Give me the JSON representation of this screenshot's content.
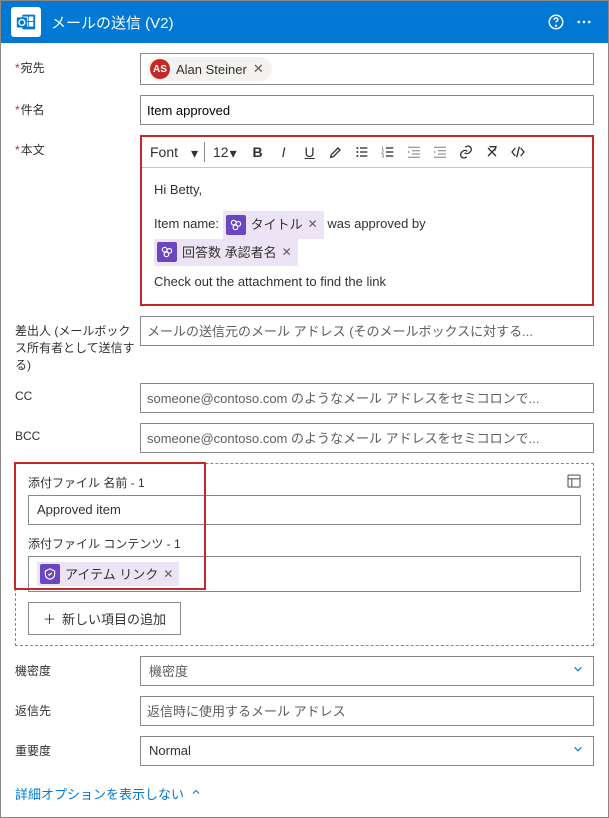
{
  "header": {
    "title": "メールの送信 (V2)"
  },
  "fields": {
    "to": {
      "label": "宛先",
      "recipient": {
        "initials": "AS",
        "name": "Alan Steiner"
      }
    },
    "subject": {
      "label": "件名",
      "value": "Item approved"
    },
    "body": {
      "label": "本文",
      "font_label": "Font",
      "size_label": "12",
      "greeting": "Hi Betty,",
      "line2_prefix": "Item name:",
      "token_title": "タイトル",
      "line2_suffix": "was approved by",
      "token_approver": "回答数 承認者名",
      "line3": "Check out the attachment to find the link"
    },
    "from": {
      "label": "差出人 (メールボックス所有者として送信する)",
      "placeholder": "メールの送信元のメール アドレス (そのメールボックスに対する..."
    },
    "cc": {
      "label": "CC",
      "placeholder": "someone@contoso.com のようなメール アドレスをセミコロンで..."
    },
    "bcc": {
      "label": "BCC",
      "placeholder": "someone@contoso.com のようなメール アドレスをセミコロンで..."
    },
    "attach_name": {
      "label": "添付ファイル 名前 - 1",
      "value": "Approved item"
    },
    "attach_content": {
      "label": "添付ファイル コンテンツ - 1",
      "token": "アイテム リンク"
    },
    "add_item": "新しい項目の追加",
    "sensitivity": {
      "label": "機密度",
      "placeholder": "機密度"
    },
    "replyto": {
      "label": "返信先",
      "placeholder": "返信時に使用するメール アドレス"
    },
    "importance": {
      "label": "重要度",
      "value": "Normal"
    }
  },
  "footer": {
    "link": "詳細オプションを表示しない"
  }
}
